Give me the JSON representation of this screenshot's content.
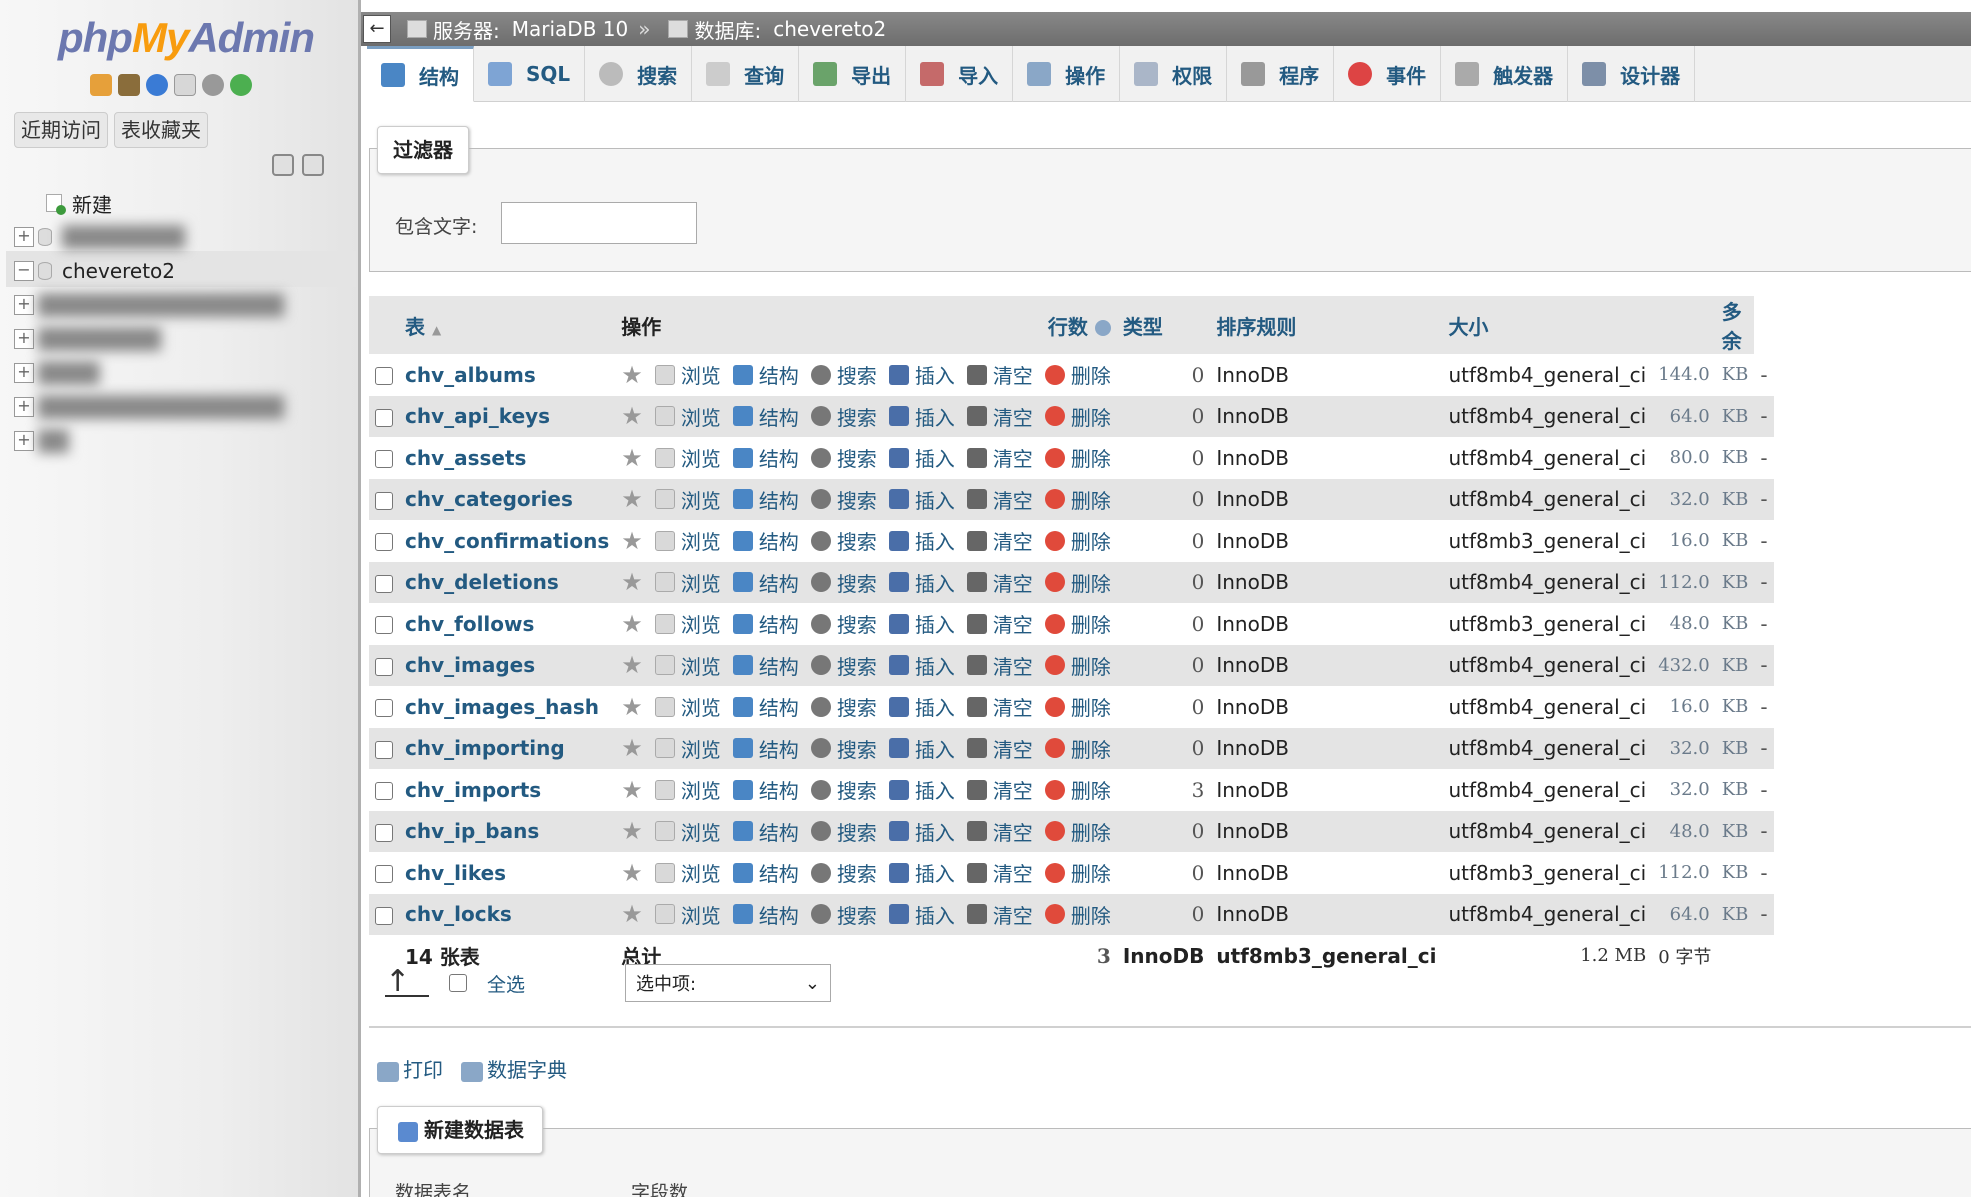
{
  "sidebar": {
    "logo": {
      "php": "php",
      "my": "My",
      "admin": "Admin"
    },
    "recent": "近期访问",
    "favorites": "表收藏夹",
    "tree": {
      "new": "新建",
      "selected_db": "chevereto2"
    }
  },
  "breadcrumb": {
    "server_label": "服务器:",
    "server_value": "MariaDB 10",
    "separator": "»",
    "db_label": "数据库:",
    "db_value": "chevereto2"
  },
  "tabs": [
    {
      "label": "结构",
      "icon": "structure-icon"
    },
    {
      "label": "SQL",
      "icon": "sql-icon"
    },
    {
      "label": "搜索",
      "icon": "search-icon"
    },
    {
      "label": "查询",
      "icon": "query-icon"
    },
    {
      "label": "导出",
      "icon": "export-icon"
    },
    {
      "label": "导入",
      "icon": "import-icon"
    },
    {
      "label": "操作",
      "icon": "wrench-icon"
    },
    {
      "label": "权限",
      "icon": "privileges-icon"
    },
    {
      "label": "程序",
      "icon": "routines-icon"
    },
    {
      "label": "事件",
      "icon": "clock-icon"
    },
    {
      "label": "触发器",
      "icon": "triggers-icon"
    },
    {
      "label": "设计器",
      "icon": "designer-icon"
    }
  ],
  "filter": {
    "legend": "过滤器",
    "label": "包含文字:",
    "value": ""
  },
  "table": {
    "headers": {
      "table": "表",
      "actions": "操作",
      "rows": "行数",
      "type": "类型",
      "collation": "排序规则",
      "size": "大小",
      "overhead": "多余"
    },
    "actions": {
      "browse": "浏览",
      "structure": "结构",
      "search": "搜索",
      "insert": "插入",
      "empty": "清空",
      "drop": "删除"
    },
    "rows": [
      {
        "name": "chv_albums",
        "rows": "0",
        "type": "InnoDB",
        "collation": "utf8mb4_general_ci",
        "size": "144.0",
        "unit": "KB",
        "overhead": "-"
      },
      {
        "name": "chv_api_keys",
        "rows": "0",
        "type": "InnoDB",
        "collation": "utf8mb4_general_ci",
        "size": "64.0",
        "unit": "KB",
        "overhead": "-"
      },
      {
        "name": "chv_assets",
        "rows": "0",
        "type": "InnoDB",
        "collation": "utf8mb4_general_ci",
        "size": "80.0",
        "unit": "KB",
        "overhead": "-"
      },
      {
        "name": "chv_categories",
        "rows": "0",
        "type": "InnoDB",
        "collation": "utf8mb4_general_ci",
        "size": "32.0",
        "unit": "KB",
        "overhead": "-"
      },
      {
        "name": "chv_confirmations",
        "rows": "0",
        "type": "InnoDB",
        "collation": "utf8mb3_general_ci",
        "size": "16.0",
        "unit": "KB",
        "overhead": "-"
      },
      {
        "name": "chv_deletions",
        "rows": "0",
        "type": "InnoDB",
        "collation": "utf8mb4_general_ci",
        "size": "112.0",
        "unit": "KB",
        "overhead": "-"
      },
      {
        "name": "chv_follows",
        "rows": "0",
        "type": "InnoDB",
        "collation": "utf8mb3_general_ci",
        "size": "48.0",
        "unit": "KB",
        "overhead": "-"
      },
      {
        "name": "chv_images",
        "rows": "0",
        "type": "InnoDB",
        "collation": "utf8mb4_general_ci",
        "size": "432.0",
        "unit": "KB",
        "overhead": "-"
      },
      {
        "name": "chv_images_hash",
        "rows": "0",
        "type": "InnoDB",
        "collation": "utf8mb4_general_ci",
        "size": "16.0",
        "unit": "KB",
        "overhead": "-"
      },
      {
        "name": "chv_importing",
        "rows": "0",
        "type": "InnoDB",
        "collation": "utf8mb4_general_ci",
        "size": "32.0",
        "unit": "KB",
        "overhead": "-"
      },
      {
        "name": "chv_imports",
        "rows": "3",
        "type": "InnoDB",
        "collation": "utf8mb4_general_ci",
        "size": "32.0",
        "unit": "KB",
        "overhead": "-"
      },
      {
        "name": "chv_ip_bans",
        "rows": "0",
        "type": "InnoDB",
        "collation": "utf8mb4_general_ci",
        "size": "48.0",
        "unit": "KB",
        "overhead": "-"
      },
      {
        "name": "chv_likes",
        "rows": "0",
        "type": "InnoDB",
        "collation": "utf8mb3_general_ci",
        "size": "112.0",
        "unit": "KB",
        "overhead": "-"
      },
      {
        "name": "chv_locks",
        "rows": "0",
        "type": "InnoDB",
        "collation": "utf8mb4_general_ci",
        "size": "64.0",
        "unit": "KB",
        "overhead": "-"
      }
    ],
    "total": {
      "count": "14 张表",
      "label": "总计",
      "rows": "3",
      "type": "InnoDB",
      "collation": "utf8mb3_general_ci",
      "size": "1.2 MB",
      "overhead": "0 字节"
    }
  },
  "footer": {
    "select_all": "全选",
    "with_selected": "选中项:",
    "print": "打印",
    "data_dictionary": "数据字典",
    "create_table": "新建数据表",
    "table_name_label": "数据表名",
    "columns_label": "字段数"
  }
}
